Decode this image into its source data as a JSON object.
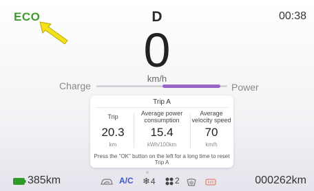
{
  "status": {
    "mode": "ECO",
    "gear": "D",
    "time": "00:38"
  },
  "speedometer": {
    "value": "0",
    "unit": "km/h"
  },
  "power_meter": {
    "left_label": "Charge",
    "right_label": "Power",
    "level": 0.5
  },
  "trip_card": {
    "title": "Trip A",
    "columns": [
      {
        "header": "Trip",
        "value": "20.3",
        "unit": "km"
      },
      {
        "header": "Average power consumption",
        "value": "15.4",
        "unit": "kWh/100km"
      },
      {
        "header": "Average velocity speed",
        "value": "70",
        "unit": "km/h"
      }
    ],
    "note": "Press the \"OK\" button on the left for a long time to reset Trip A"
  },
  "bottom_bar": {
    "range": "385km",
    "ac_label": "A/C",
    "fan_speed": "4",
    "seat_level": "2",
    "odometer": "000262km"
  },
  "colors": {
    "eco_green": "#3f9b2c",
    "ac_blue": "#3b57c4",
    "power_purple": "#9a63c6",
    "arrow_yellow": "#f5e11a"
  },
  "icons": [
    "yellow-arrow-icon",
    "battery-icon",
    "recirculation-icon",
    "fan-icon",
    "seat-heat-icon",
    "windshield-heat-icon",
    "rear-defrost-icon"
  ]
}
